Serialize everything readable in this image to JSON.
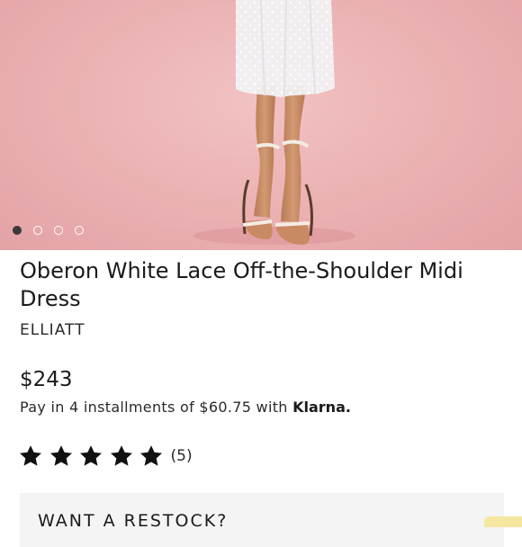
{
  "product": {
    "title": "Oberon White Lace Off-the-Shoulder Midi Dress",
    "brand": "ELLIATT",
    "price": "$243",
    "installments_text": "Pay in 4 installments of $60.75 with",
    "klarna_label": "Klarna."
  },
  "gallery": {
    "image_count": 4,
    "active_index": 0
  },
  "rating": {
    "stars": 5,
    "max_stars": 5,
    "count_text": "(5)"
  },
  "restock": {
    "label": "WANT A RESTOCK?"
  },
  "colors": {
    "hero_background": "#eab0b2",
    "dress": "#f2f2f4",
    "text": "#1a1a1a",
    "restock_panel": "#f4f4f4"
  }
}
